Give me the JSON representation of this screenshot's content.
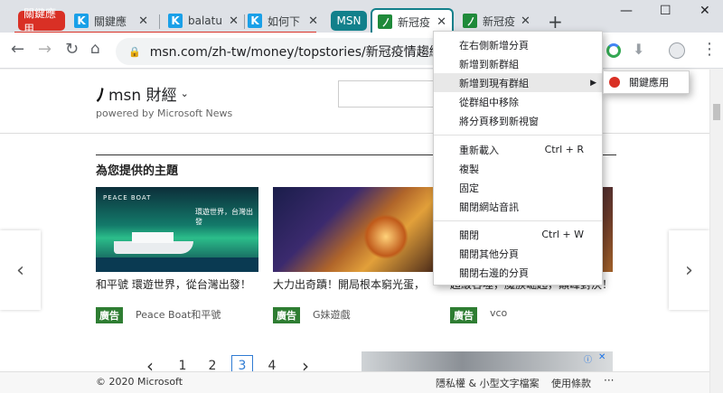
{
  "tabs": {
    "group1_label": "關鍵應用",
    "tab1": "關鍵應",
    "tab2": "balatu",
    "tab3": "如何下",
    "group2_label": "MSN",
    "tab4": "新冠疫",
    "tab5": "新冠疫",
    "new_tab": "+"
  },
  "window": {
    "minimize": "—",
    "maximize": "☐",
    "close": "✕"
  },
  "toolbar": {
    "url": "msn.com/zh-tw/money/topstories/新冠疫情趨緩-美國"
  },
  "page": {
    "logo_text": "msn 財經",
    "powered_by": "powered by Microsoft News",
    "section_title": "為您提供的主題",
    "cards": [
      {
        "title": "和平號 環遊世界，從台灣出發！",
        "ad": "廣告",
        "sponsor": "Peace Boat和平號",
        "banner_brand": "PEACE BOAT",
        "banner_text": "環遊世界，台灣出發"
      },
      {
        "title": "大力出奇蹟！開局根本窮光蛋，",
        "ad": "廣告",
        "sponsor": "G妹遊戲"
      },
      {
        "title": "超級吞噬，魔族崛起，巔峰對決！",
        "ad": "廣告",
        "sponsor": "vco"
      }
    ],
    "pagination": [
      "1",
      "2",
      "3",
      "4"
    ],
    "current_page": "3",
    "footer_copyright": "© 2020 Microsoft",
    "footer_privacy": "隱私權 & 小型文字檔案",
    "footer_terms": "使用條款",
    "footer_more": "···"
  },
  "context_menu": {
    "items": [
      "在右側新增分頁",
      "新增到新群組",
      "新增到現有群組",
      "從群組中移除",
      "將分頁移到新視窗",
      "重新載入",
      "複製",
      "固定",
      "關閉網站音訊",
      "關閉",
      "關閉其他分頁",
      "關閉右邊的分頁"
    ],
    "shortcut_reload": "Ctrl + R",
    "shortcut_close": "Ctrl + W",
    "submenu_item": "關鍵應用"
  },
  "colors": {
    "group1": "#d93025",
    "group2": "#12808b",
    "ad_badge": "#2e7d32"
  }
}
